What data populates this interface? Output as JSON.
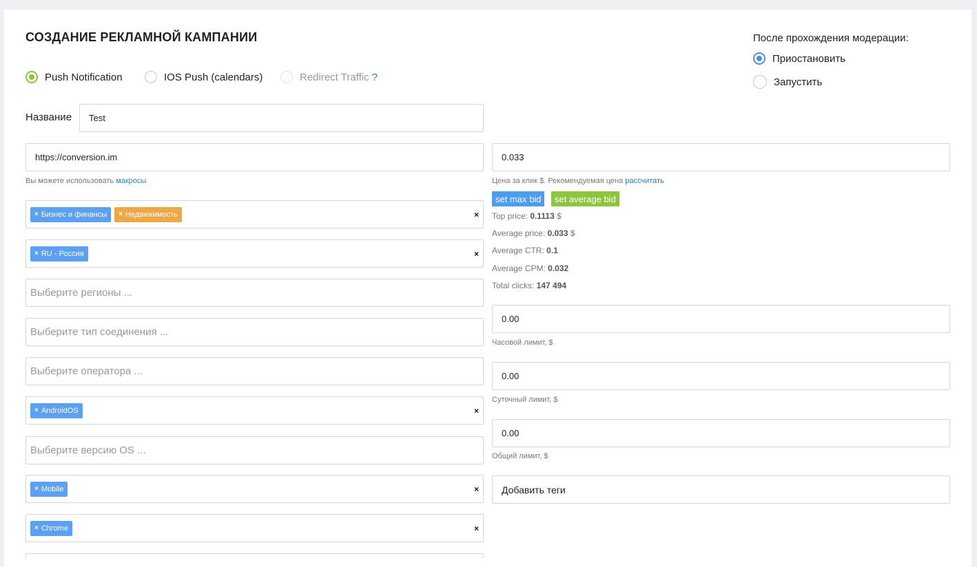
{
  "title": "СОЗДАНИЕ РЕКЛАМНОЙ КАМПАНИИ",
  "campaign_types": [
    {
      "label": "Push Notification",
      "selected": true,
      "disabled": false
    },
    {
      "label": "IOS Push (calendars)",
      "selected": false,
      "disabled": false
    },
    {
      "label": "Redirect Traffic",
      "selected": false,
      "disabled": true,
      "help": "?"
    }
  ],
  "moderation": {
    "label": "После прохождения модерации:",
    "options": [
      {
        "label": "Приостановить",
        "selected": true
      },
      {
        "label": "Запустить",
        "selected": false
      }
    ]
  },
  "name_field": {
    "label": "Название",
    "value": "Test"
  },
  "url_field": {
    "value": "https://conversion.im"
  },
  "url_hint": {
    "text": "Вы можете использовать",
    "link": "макросы"
  },
  "categories": [
    "Бизнес и финансы",
    "Недвижимость"
  ],
  "countries": [
    "RU - Россия"
  ],
  "placeholders": {
    "regions": "Выберите регионы ...",
    "connection": "Выберите тип соединения ...",
    "operator": "Выберите оператора ...",
    "os_version": "Выберите версию OS ..."
  },
  "os": [
    "AndroidOS"
  ],
  "device": [
    "Mobile"
  ],
  "browser": [
    "Chrome"
  ],
  "tag_remove_glyph": "×",
  "clear_glyph": "×",
  "price": {
    "value": "0.033",
    "hint": "Цена за клик $. Рекомендуемая цена",
    "hint_link": "рассчитать",
    "max_bid_button": "set max bid",
    "avg_bid_button": "set average bid"
  },
  "stats": [
    {
      "label": "Top price:",
      "value": "0.1113",
      "unit": "$"
    },
    {
      "label": "Average price:",
      "value": "0.033",
      "unit": "$"
    },
    {
      "label": "Average CTR:",
      "value": "0.1",
      "unit": ""
    },
    {
      "label": "Average CPM:",
      "value": "0.032",
      "unit": ""
    },
    {
      "label": "Total clicks:",
      "value": "147 494",
      "unit": ""
    }
  ],
  "limits": [
    {
      "value": "0.00",
      "label": "Часовой лимит, $"
    },
    {
      "value": "0.00",
      "label": "Суточный лимит, $"
    },
    {
      "value": "0.00",
      "label": "Общий лимит, $"
    }
  ],
  "tags_field": {
    "placeholder": "Добавить теги"
  },
  "colors": {
    "accent_green": "#8cc63f",
    "accent_blue": "#4a90e2",
    "tag_blue": "#5ba0f2",
    "tag_orange": "#eda744"
  }
}
